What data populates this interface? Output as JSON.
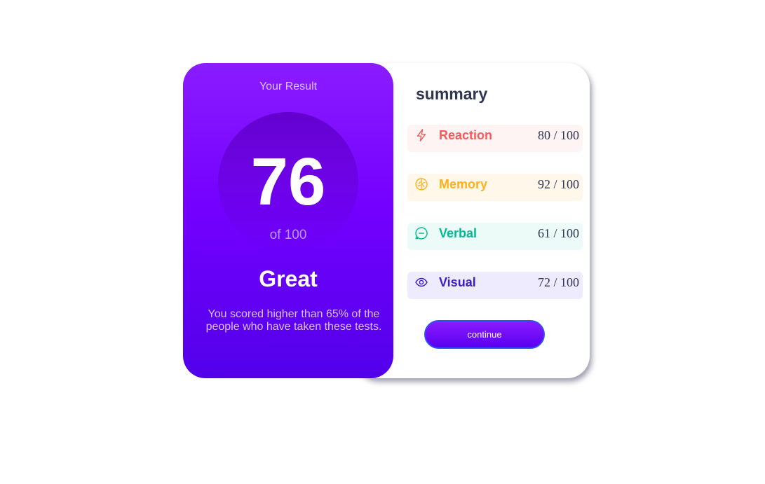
{
  "result": {
    "heading": "Your Result",
    "score": "76",
    "max_label": "of 100",
    "rating": "Great",
    "description": "You scored higher than 65% of the people who have taken these tests."
  },
  "summary": {
    "title": "summary",
    "items": [
      {
        "icon": "lightning-icon",
        "label": "Reaction",
        "score": "80",
        "max": "100",
        "color": "#f55a5a",
        "bg": "#fff4f4"
      },
      {
        "icon": "brain-icon",
        "label": "Memory",
        "score": "92",
        "max": "100",
        "color": "#ffb01f",
        "bg": "#fff7ea"
      },
      {
        "icon": "chat-bubble-icon",
        "label": "Verbal",
        "score": "61",
        "max": "100",
        "color": "#00bb8f",
        "bg": "#ecfbf7"
      },
      {
        "icon": "eye-icon",
        "label": "Visual",
        "score": "72",
        "max": "100",
        "color": "#3b1bcc",
        "bg": "#eeebfe"
      }
    ],
    "separator": "/"
  },
  "actions": {
    "continue_label": "continue"
  },
  "colors": {
    "gradient_top": "#8a1cff",
    "gradient_bottom": "#5200ea",
    "title": "#2f3451"
  }
}
